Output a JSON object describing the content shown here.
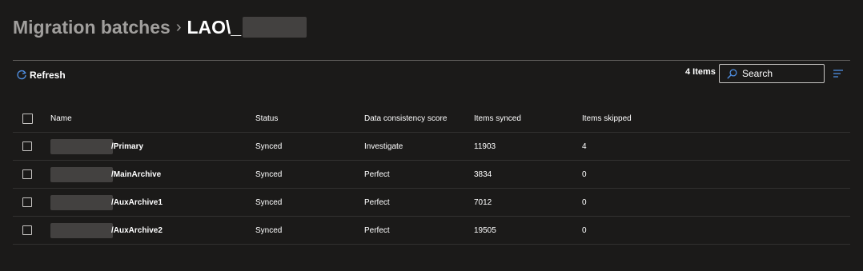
{
  "breadcrumb": {
    "parent": "Migration batches",
    "separator": "›",
    "current": "LAO\\_"
  },
  "toolbar": {
    "refresh_label": "Refresh",
    "item_count": "4 Items",
    "search_placeholder": "Search"
  },
  "table": {
    "columns": [
      "Name",
      "Status",
      "Data consistency score",
      "Items synced",
      "Items skipped"
    ],
    "rows": [
      {
        "name": "/Primary",
        "status": "Synced",
        "score": "Investigate",
        "synced": "11903",
        "skipped": "4"
      },
      {
        "name": "/MainArchive",
        "status": "Synced",
        "score": "Perfect",
        "synced": "3834",
        "skipped": "0"
      },
      {
        "name": "/AuxArchive1",
        "status": "Synced",
        "score": "Perfect",
        "synced": "7012",
        "skipped": "0"
      },
      {
        "name": "/AuxArchive2",
        "status": "Synced",
        "score": "Perfect",
        "synced": "19505",
        "skipped": "0"
      }
    ]
  },
  "colors": {
    "background": "#1b1a19",
    "accent": "#4f8ee0",
    "muted_text": "#a19f9d",
    "redaction": "#434140"
  },
  "icons": [
    "refresh-icon",
    "search-icon",
    "filter-icon"
  ]
}
